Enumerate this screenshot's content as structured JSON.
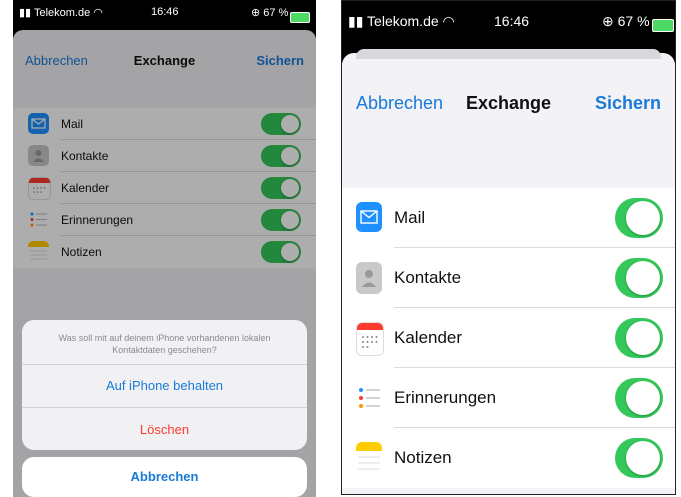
{
  "status": {
    "carrier": "Telekom.de",
    "time": "16:46",
    "battery": "67 %"
  },
  "nav": {
    "cancel": "Abbrechen",
    "title": "Exchange",
    "save": "Sichern"
  },
  "services": [
    {
      "label": "Mail",
      "icon": "mail-icon",
      "on": true
    },
    {
      "label": "Kontakte",
      "icon": "contacts-icon",
      "on": true
    },
    {
      "label": "Kalender",
      "icon": "calendar-icon",
      "on": true
    },
    {
      "label": "Erinnerungen",
      "icon": "reminders-icon",
      "on": true
    },
    {
      "label": "Notizen",
      "icon": "notes-icon",
      "on": true
    }
  ],
  "action_sheet": {
    "message": "Was soll mit auf deinem iPhone vorhandenen lokalen Kontaktdaten geschehen?",
    "keep": "Auf iPhone behalten",
    "delete": "Löschen",
    "cancel": "Abbrechen"
  },
  "colors": {
    "accent": "#1a7ad9",
    "toggle_on": "#34c759",
    "destructive": "#ff3b30"
  }
}
